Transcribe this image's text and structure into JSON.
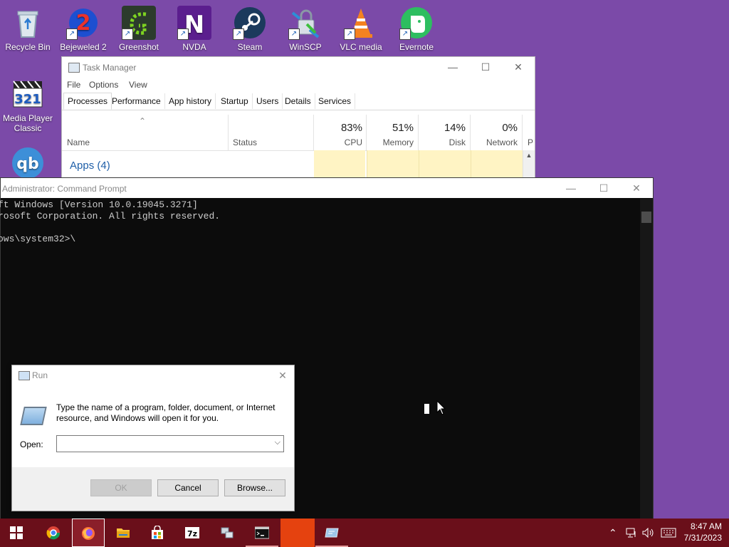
{
  "desktop": {
    "icons": [
      {
        "label": "Recycle Bin"
      },
      {
        "label": "Bejeweled 2"
      },
      {
        "label": "Greenshot"
      },
      {
        "label": "NVDA"
      },
      {
        "label": "Steam"
      },
      {
        "label": "WinSCP"
      },
      {
        "label": "VLC media"
      },
      {
        "label": "Evernote"
      },
      {
        "label_line1": "Media Player",
        "label_line2": "Classic"
      },
      {
        "label": "qb"
      }
    ]
  },
  "task_manager": {
    "title": "Task Manager",
    "menu": [
      "File",
      "Options",
      "View"
    ],
    "tabs": [
      "Processes",
      "Performance",
      "App history",
      "Startup",
      "Users",
      "Details",
      "Services"
    ],
    "columns": {
      "name": "Name",
      "status": "Status",
      "cpu": {
        "pct": "83%",
        "label": "CPU"
      },
      "memory": {
        "pct": "51%",
        "label": "Memory"
      },
      "disk": {
        "pct": "14%",
        "label": "Disk"
      },
      "network": {
        "pct": "0%",
        "label": "Network"
      },
      "next": "P"
    },
    "group": "Apps (4)"
  },
  "cmd": {
    "title": "Administrator: Command Prompt",
    "lines": [
      "ft Windows [Version 10.0.19045.3271]",
      "rosoft Corporation. All rights reserved.",
      "",
      "ows\\system32>\\"
    ]
  },
  "run": {
    "title": "Run",
    "description": "Type the name of a program, folder, document, or Internet resource, and Windows will open it for you.",
    "open_label": "Open:",
    "open_value": "",
    "ok_label": "OK",
    "cancel_label": "Cancel",
    "browse_label": "Browse..."
  },
  "taskbar": {
    "time": "8:47 AM",
    "date": "7/31/2023"
  },
  "colors": {
    "desktop_bg": "#7b4aa8",
    "taskbar_bg": "#6a0f1a",
    "heat_cell": "#fff4c4",
    "apps_text": "#1f5fa8"
  }
}
